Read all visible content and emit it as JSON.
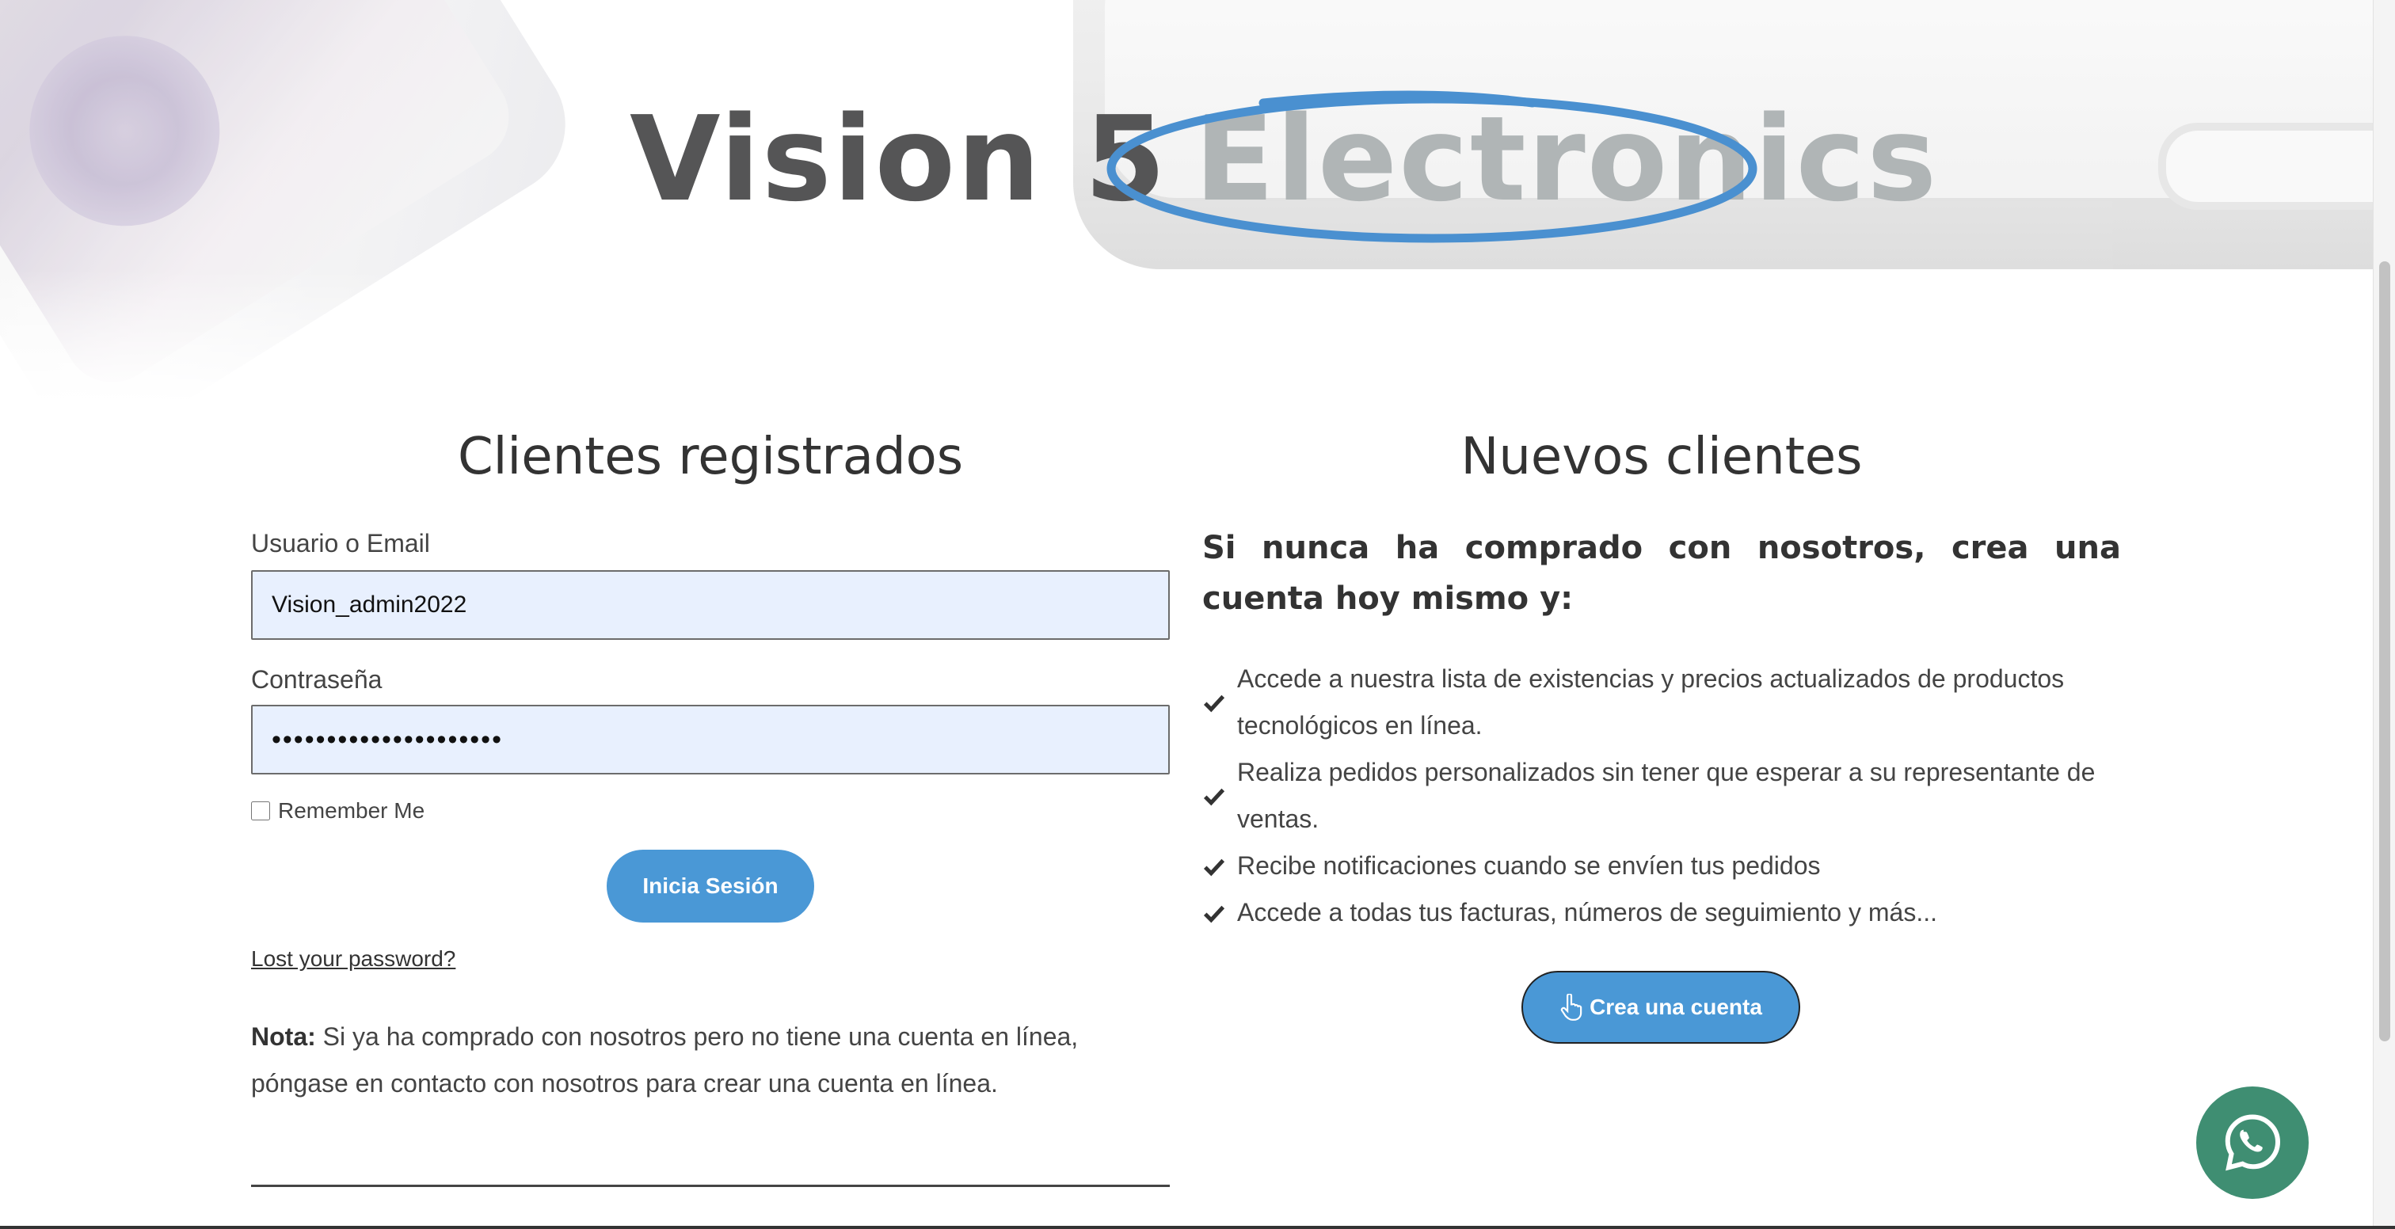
{
  "brand": {
    "part1": "Vision 5",
    "part2": "Electronics"
  },
  "login": {
    "title": "Clientes registrados",
    "username_label": "Usuario o Email",
    "username_value": "Vision_admin2022",
    "password_label": "Contraseña",
    "password_value": "supersecretpassword12",
    "remember_label": "Remember Me",
    "submit_label": "Inicia Sesión",
    "lost_password": "Lost your password?",
    "note_bold": "Nota:",
    "note_text": " Si ya ha comprado con nosotros pero no tiene una cuenta en línea, póngase en contacto con nosotros para crear una cuenta en línea."
  },
  "register": {
    "title": "Nuevos clientes",
    "intro": "Si nunca ha comprado con nosotros, crea una cuenta hoy mismo y:",
    "benefits": [
      "Accede a nuestra lista de existencias y precios actualizados de productos tecnológicos en línea.",
      "Realiza pedidos personalizados sin tener que esperar a su representante de ventas.",
      "Recibe notificaciones cuando se envíen tus pedidos",
      "Accede a todas tus facturas, números de seguimiento y más..."
    ],
    "create_label": "Crea una cuenta"
  },
  "colors": {
    "accent": "#4a98d6",
    "input_bg": "#e8f0fe",
    "whatsapp": "#3f8e72"
  },
  "icons": {
    "check": "check-icon",
    "pointer": "hand-pointer-icon",
    "whatsapp": "whatsapp-icon"
  }
}
